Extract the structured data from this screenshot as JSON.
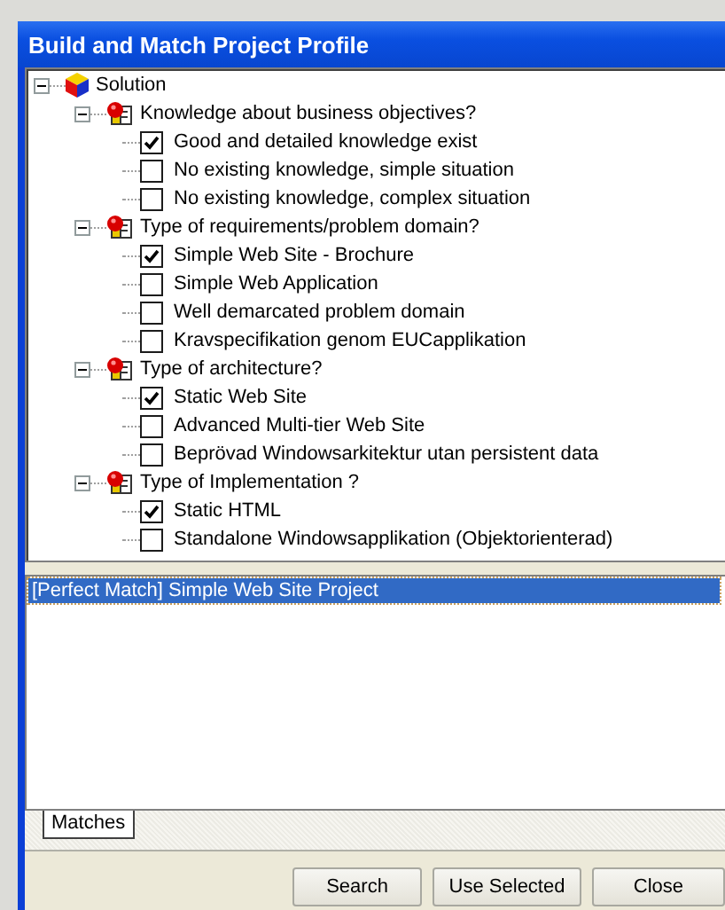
{
  "window": {
    "title": "Build and Match Project Profile"
  },
  "tree": [
    {
      "kind": "root",
      "label": "Solution",
      "expanded": true,
      "children": [
        {
          "kind": "category",
          "label": "Knowledge about business objectives?",
          "expanded": true,
          "children": [
            {
              "kind": "option",
              "label": "Good and detailed knowledge exist",
              "checked": true
            },
            {
              "kind": "option",
              "label": "No existing knowledge, simple situation",
              "checked": false
            },
            {
              "kind": "option",
              "label": "No existing knowledge, complex situation",
              "checked": false
            }
          ]
        },
        {
          "kind": "category",
          "label": "Type of requirements/problem domain?",
          "expanded": true,
          "children": [
            {
              "kind": "option",
              "label": "Simple Web Site - Brochure",
              "checked": true
            },
            {
              "kind": "option",
              "label": "Simple Web Application",
              "checked": false
            },
            {
              "kind": "option",
              "label": "Well demarcated problem domain",
              "checked": false
            },
            {
              "kind": "option",
              "label": "Kravspecifikation genom EUCapplikation",
              "checked": false
            }
          ]
        },
        {
          "kind": "category",
          "label": "Type of architecture?",
          "expanded": true,
          "children": [
            {
              "kind": "option",
              "label": "Static Web Site",
              "checked": true
            },
            {
              "kind": "option",
              "label": "Advanced Multi-tier Web Site",
              "checked": false
            },
            {
              "kind": "option",
              "label": "Beprövad Windowsarkitektur utan persistent data",
              "checked": false
            }
          ]
        },
        {
          "kind": "category",
          "label": "Type of Implementation ?",
          "expanded": true,
          "children": [
            {
              "kind": "option",
              "label": "Static HTML",
              "checked": true
            },
            {
              "kind": "option",
              "label": "Standalone Windowsapplikation (Objektorienterad)",
              "checked": false
            }
          ]
        }
      ]
    }
  ],
  "matches": [
    {
      "label": "[Perfect Match] Simple Web Site Project",
      "selected": true
    }
  ],
  "tabs": [
    {
      "label": "Matches",
      "selected": true
    }
  ],
  "buttons": [
    "Search",
    "Use Selected",
    "Close"
  ]
}
